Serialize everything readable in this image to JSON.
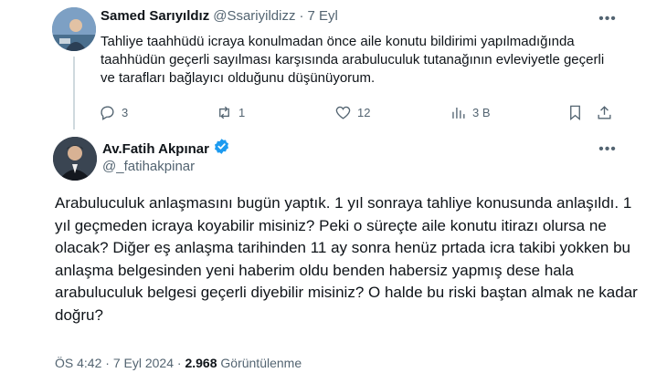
{
  "reply": {
    "author_name": "Samed Sarıyıldız",
    "handle": "@Ssariyildizz",
    "separator": "·",
    "date": "7 Eyl",
    "text": "Tahliye taahhüdü icraya konulmadan önce aile konutu bildirimi yapılmadığında  taahhüdün geçerli sayılması karşısında arabuluculuk tutanağının evleviyetle geçerli ve tarafları bağlayıcı olduğunu düşünüyorum.",
    "stats": {
      "replies": "3",
      "retweets": "1",
      "likes": "12",
      "views": "3 B"
    }
  },
  "main": {
    "author_name": "Av.Fatih Akpınar",
    "handle": "@_fatihakpinar",
    "text": "Arabuluculuk anlaşmasını bugün yaptık. 1 yıl sonraya tahliye konusunda anlaşıldı. 1 yıl geçmeden icraya koyabilir misiniz? Peki o süreçte aile konutu itirazı olursa ne olacak? Diğer eş anlaşma tarihinden 11 ay sonra henüz prtada icra takibi yokken bu anlaşma belgesinden yeni haberim oldu benden habersiz yapmış dese hala arabuluculuk belgesi geçerli diyebilir misiniz? O halde bu riski baştan almak ne kadar doğru?",
    "time": "ÖS 4:42",
    "separator": "·",
    "date": "7 Eyl 2024",
    "views_count": "2.968",
    "views_label": "Görüntülenme"
  },
  "icons": {
    "more": "ellipsis-icon",
    "reply": "reply-bubble-icon",
    "retweet": "retweet-icon",
    "like": "heart-icon",
    "views": "bar-chart-icon",
    "bookmark": "bookmark-icon",
    "share": "share-icon",
    "verified": "verified-badge-icon"
  },
  "colors": {
    "text": "#0f1419",
    "muted": "#536471",
    "verified": "#1d9bf0",
    "thread_line": "#cfd9de"
  }
}
